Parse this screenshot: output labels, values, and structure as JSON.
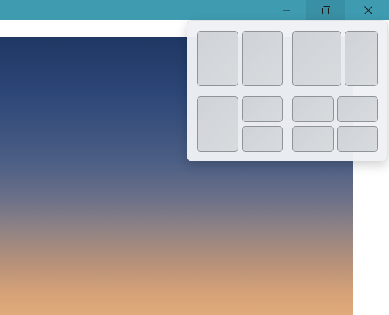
{
  "window": {
    "titlebar_color": "#3f9bb0",
    "caption_buttons": [
      {
        "name": "minimize",
        "icon": "minimize-icon"
      },
      {
        "name": "restore",
        "icon": "restore-icon"
      },
      {
        "name": "close",
        "icon": "close-icon"
      }
    ]
  },
  "snap_layouts": {
    "layouts": [
      {
        "name": "two-columns-equal",
        "zones": 2
      },
      {
        "name": "two-columns-wide-left",
        "zones": 2
      },
      {
        "name": "one-left-two-right",
        "zones": 3
      },
      {
        "name": "four-grid",
        "zones": 4
      }
    ]
  },
  "background": {
    "type": "sunset-sky-photo",
    "colors": [
      "#1f3864",
      "#4c5f85",
      "#8c8185",
      "#e0aa7a"
    ]
  }
}
